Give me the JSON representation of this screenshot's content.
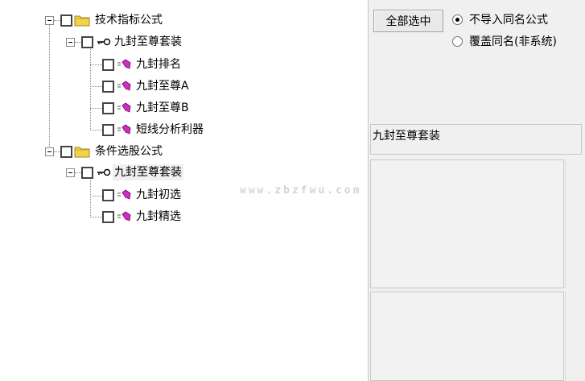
{
  "tree": {
    "groups": [
      {
        "label": "技术指标公式",
        "children": [
          {
            "label": "九封至尊套装",
            "children": [
              "九封排名",
              "九封至尊A",
              "九封至尊B",
              "短线分析利器"
            ]
          }
        ]
      },
      {
        "label": "条件选股公式",
        "children": [
          {
            "label": "九封至尊套装",
            "children": [
              "九封初选",
              "九封精选"
            ]
          }
        ]
      }
    ]
  },
  "right_panel": {
    "select_all_label": "全部选中",
    "radio_options": [
      {
        "label": "不导入同名公式",
        "checked": true
      },
      {
        "label": "覆盖同名(非系统)",
        "checked": false
      }
    ],
    "name_value": "九封至尊套装",
    "textarea1": "",
    "textarea2": ""
  },
  "watermark": "www.zbzfwu.com",
  "colors": {
    "folder": "#f2d44a",
    "formula_icon": "#d02cc6",
    "panel_bg": "#f0f0f0"
  }
}
